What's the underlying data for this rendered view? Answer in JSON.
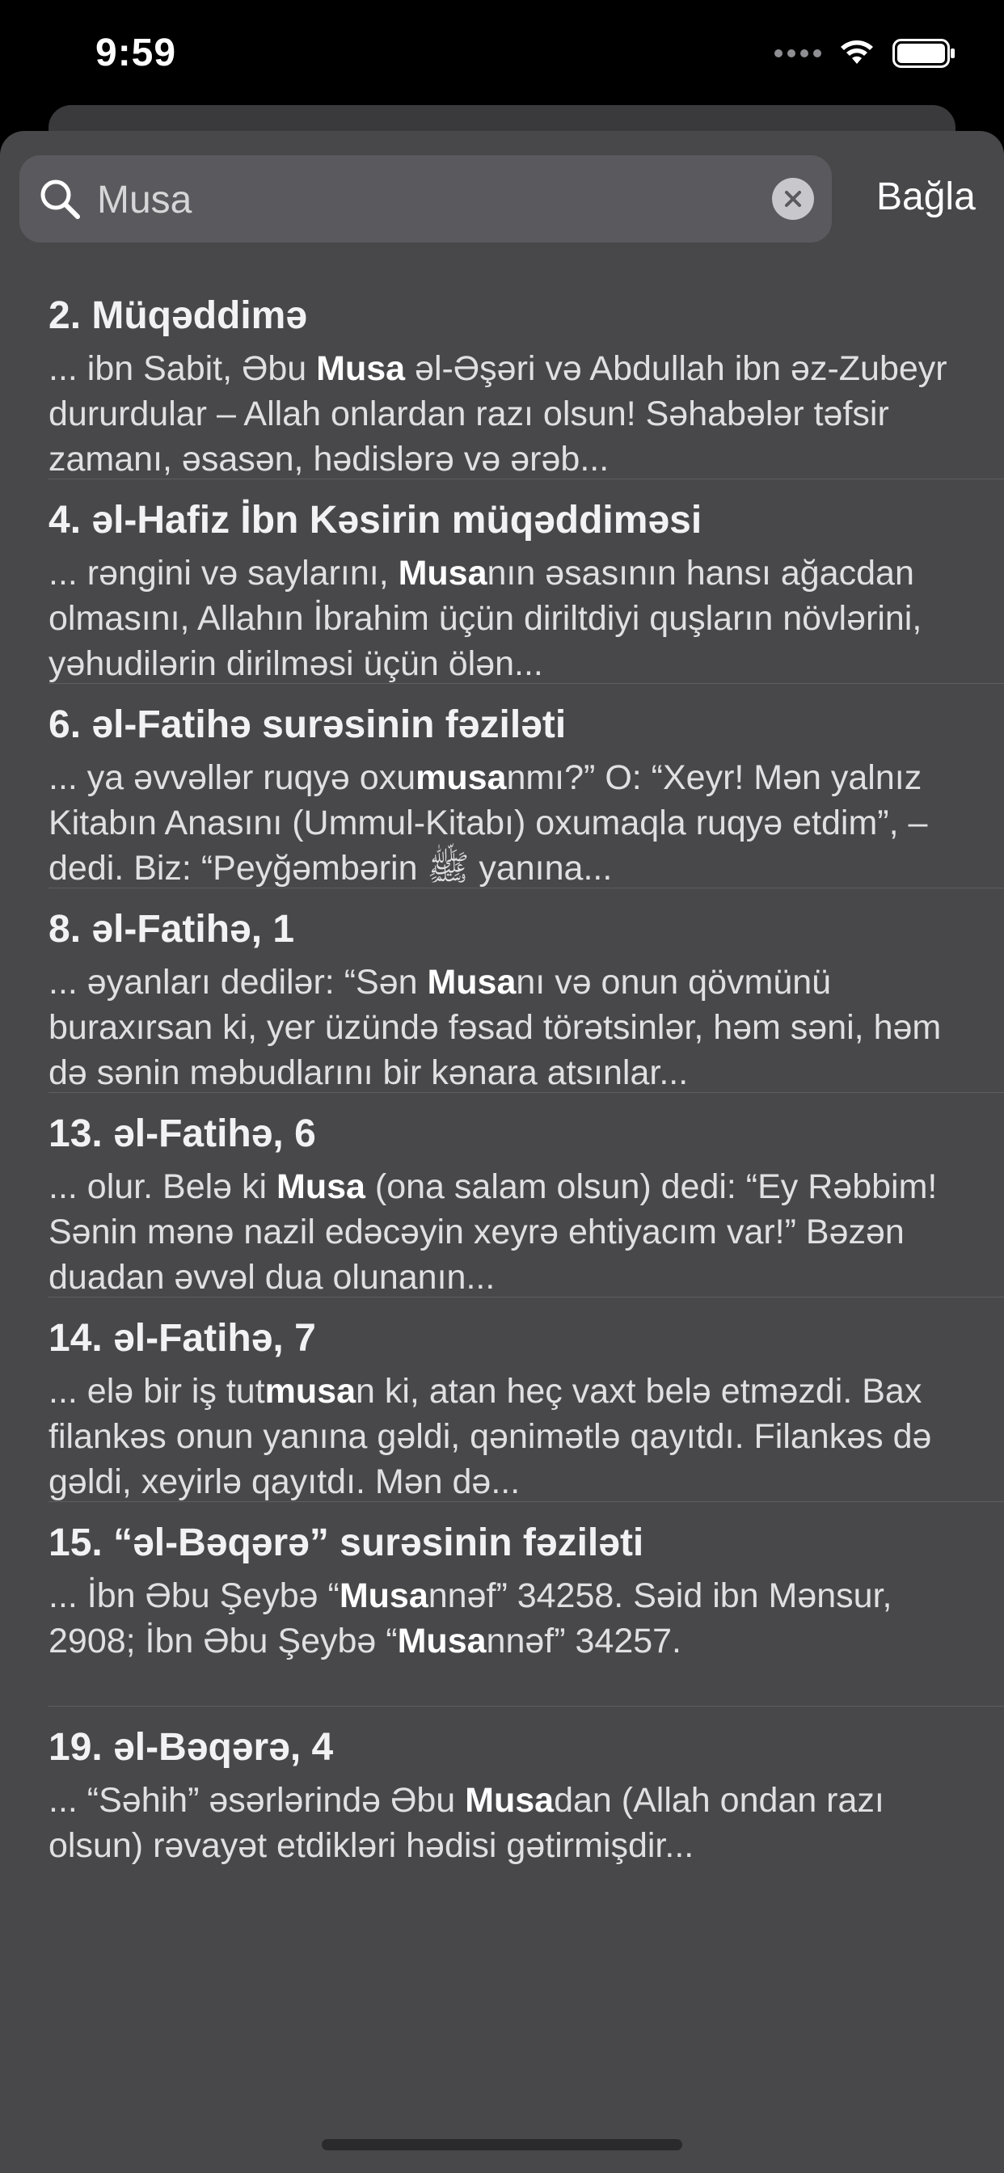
{
  "status_bar": {
    "time": "9:59"
  },
  "search": {
    "value": "Musa",
    "close_label": "Bağla"
  },
  "results": [
    {
      "title": "2. Müqəddimə",
      "snippet_parts": [
        {
          "text": "... ibn Sabit, Əbu ",
          "bold": false
        },
        {
          "text": "Musa",
          "bold": true
        },
        {
          "text": " əl-Əşəri və Abdullah ibn əz-Zubeyr dururdular – Allah onlardan razı olsun! Səhabələr təfsir zamanı, əsasən, hədislərə və ərəb...",
          "bold": false
        }
      ]
    },
    {
      "title": "4. əl-Hafiz İbn Kəsirin müqəddiməsi",
      "snippet_parts": [
        {
          "text": "... rəngini və saylarını, ",
          "bold": false
        },
        {
          "text": "Musa",
          "bold": true
        },
        {
          "text": "nın əsasının hansı ağacdan olmasını, Allahın İbrahim üçün diriltdiyi quşların növlərini, yəhudilərin dirilməsi üçün ölən...",
          "bold": false
        }
      ]
    },
    {
      "title": "6. əl-Fatihə surəsinin fəziləti",
      "snippet_parts": [
        {
          "text": "... ya əvvəllər ruqyə oxu",
          "bold": false
        },
        {
          "text": "musa",
          "bold": true
        },
        {
          "text": "nmı?” O: “Xeyr! Mən yalnız Kitabın Anasını (Ummul-Kitabı) oxumaqla ruqyə etdim”, – dedi. Biz: “Peyğəmbərin ﷺ yanına...",
          "bold": false
        }
      ]
    },
    {
      "title": "8. əl-Fatihə, 1",
      "snippet_parts": [
        {
          "text": "... əyanları dedilər: “Sən ",
          "bold": false
        },
        {
          "text": "Musa",
          "bold": true
        },
        {
          "text": "nı və onun qövmünü buraxırsan ki, yer üzündə fəsad törətsinlər, həm səni, həm də sənin məbudlarını bir kənara atsınlar...",
          "bold": false
        }
      ]
    },
    {
      "title": "13. əl-Fatihə, 6",
      "snippet_parts": [
        {
          "text": "... olur. Belə ki ",
          "bold": false
        },
        {
          "text": "Musa",
          "bold": true
        },
        {
          "text": " (ona salam olsun) dedi: “Ey Rəbbim! Sənin mənə nazil edəcəyin xeyrə ehtiyacım var!” Bəzən duadan əvvəl dua olunanın...",
          "bold": false
        }
      ]
    },
    {
      "title": "14. əl-Fatihə, 7",
      "snippet_parts": [
        {
          "text": "... elə bir iş tut",
          "bold": false
        },
        {
          "text": "musa",
          "bold": true
        },
        {
          "text": "n ki, atan heç vaxt belə etməzdi. Bax filankəs onun yanına gəldi, qənimətlə qayıtdı. Filankəs də gəldi, xeyirlə qayıtdı. Mən də...",
          "bold": false
        }
      ]
    },
    {
      "title": "15. “əl-Bəqərə” surəsinin fəziləti",
      "snippet_parts": [
        {
          "text": "... İbn Əbu Şeybə “",
          "bold": false
        },
        {
          "text": "Musa",
          "bold": true
        },
        {
          "text": "nnəf” 34258. Səid ibn Mənsur, 2908; İbn Əbu Şeybə “",
          "bold": false
        },
        {
          "text": "Musa",
          "bold": true
        },
        {
          "text": "nnəf” 34257.",
          "bold": false
        }
      ]
    },
    {
      "title": "19. əl-Bəqərə, 4",
      "snippet_parts": [
        {
          "text": "... “Səhih” əsərlərində Əbu ",
          "bold": false
        },
        {
          "text": "Musa",
          "bold": true
        },
        {
          "text": "dan (Allah ondan razı olsun) rəvayət etdikləri hədisi gətirmişdir...",
          "bold": false
        }
      ]
    }
  ]
}
